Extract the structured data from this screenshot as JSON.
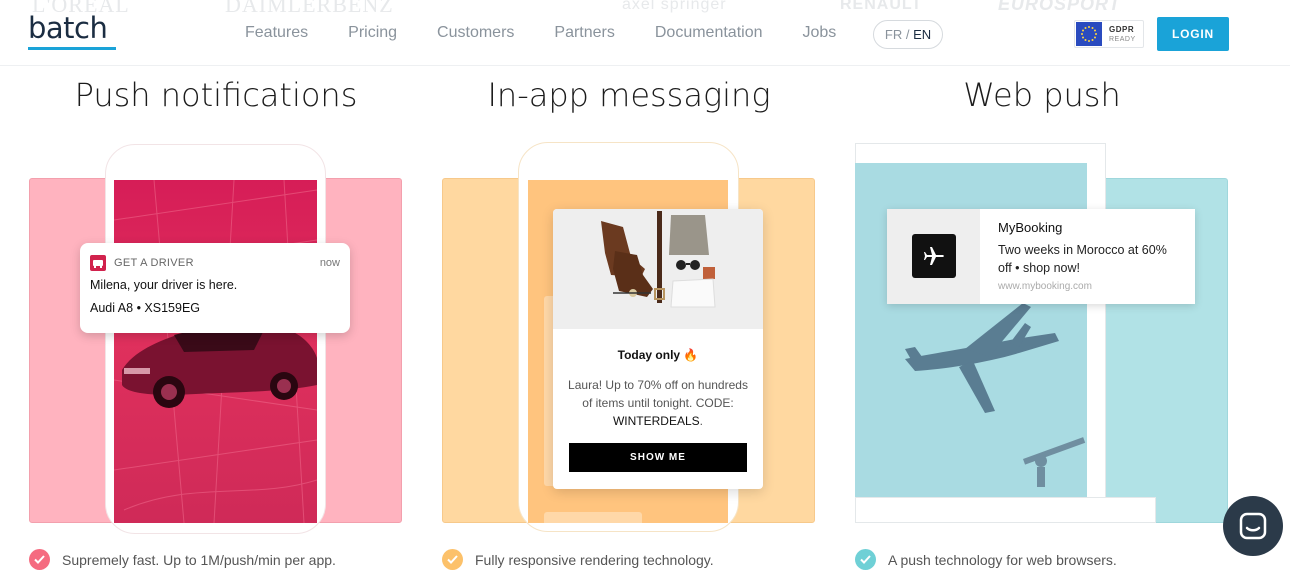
{
  "header": {
    "logo_text": "batch",
    "client_logos": [
      "L'ORÉAL",
      "DAIMLERBENZ",
      "axel springer",
      "RENAULT",
      "EUROSPORT"
    ],
    "nav": [
      "Features",
      "Pricing",
      "Customers",
      "Partners",
      "Documentation",
      "Jobs"
    ],
    "lang_fr": "FR",
    "lang_sep": " / ",
    "lang_en": "EN",
    "gdpr_line1": "GDPR",
    "gdpr_line2": "READY",
    "login": "LOGIN"
  },
  "features": [
    {
      "title": "Push notifications",
      "notification": {
        "app": "GET A DRIVER",
        "time": "now",
        "line1": "Milena, your driver is here.",
        "line2": "Audi A8 • XS159EG"
      },
      "benefit": "Supremely fast. Up to 1M/push/min per app.",
      "accent": "#f56b80"
    },
    {
      "title": "In-app messaging",
      "card": {
        "title": "Today only 🔥",
        "body": "Laura! Up to 70% off on hundreds of items until tonight. CODE: ",
        "code": "WINTERDEALS",
        "code_suffix": ".",
        "button": "SHOW ME"
      },
      "benefit": "Fully responsive rendering technology.",
      "accent": "#fcc16a"
    },
    {
      "title": "Web push",
      "notification": {
        "title": "MyBooking",
        "body": "Two weeks in Morocco at 60% off • shop now!",
        "url": "www.mybooking.com"
      },
      "benefit": "A push technology for web browsers.",
      "accent": "#6fd0d6"
    }
  ],
  "colors": {
    "brand_blue": "#1aa3d8",
    "navy": "#1b2d42",
    "pink": "#ffb3bf",
    "orange": "#ffd8a0",
    "teal": "#b1e2e6"
  }
}
